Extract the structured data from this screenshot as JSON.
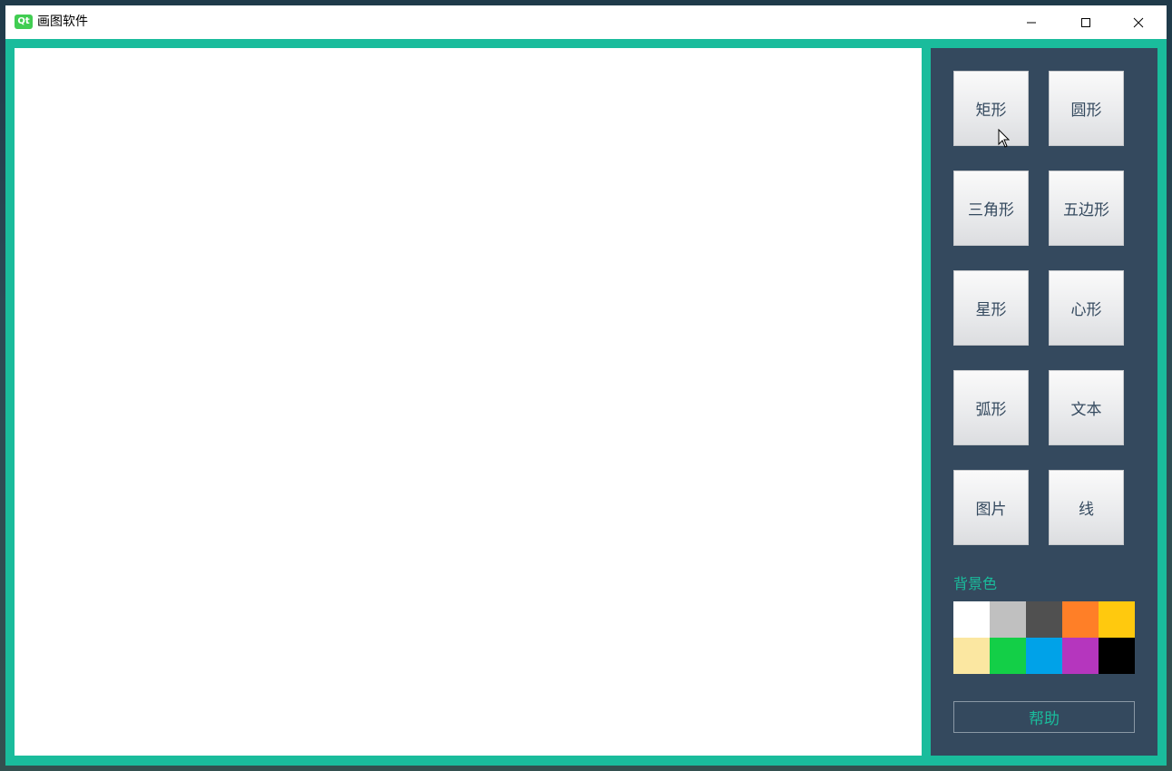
{
  "window": {
    "title": "画图软件",
    "app_icon_text": "Qt",
    "accent_color": "#1abc9c",
    "panel_color": "#34495e"
  },
  "shapes": [
    {
      "name": "shape-btn-rectangle",
      "label": "矩形"
    },
    {
      "name": "shape-btn-circle",
      "label": "圆形"
    },
    {
      "name": "shape-btn-triangle",
      "label": "三角形"
    },
    {
      "name": "shape-btn-pentagon",
      "label": "五边形"
    },
    {
      "name": "shape-btn-star",
      "label": "星形"
    },
    {
      "name": "shape-btn-heart",
      "label": "心形"
    },
    {
      "name": "shape-btn-arc",
      "label": "弧形"
    },
    {
      "name": "shape-btn-text",
      "label": "文本"
    },
    {
      "name": "shape-btn-image",
      "label": "图片"
    },
    {
      "name": "shape-btn-line",
      "label": "线"
    }
  ],
  "background": {
    "label": "背景色",
    "colors": [
      "#ffffff",
      "#c0c0c0",
      "#505050",
      "#ff7f27",
      "#ffc90e",
      "#fbe7a1",
      "#13cf47",
      "#00a2e8",
      "#b536be",
      "#000000"
    ]
  },
  "help": {
    "label": "帮助"
  }
}
